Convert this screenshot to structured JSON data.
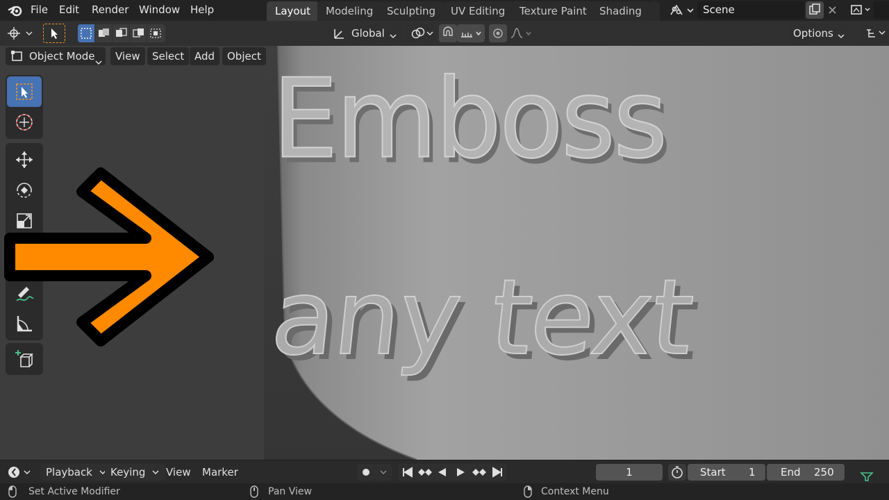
{
  "menu": {
    "items": [
      "File",
      "Edit",
      "Render",
      "Window",
      "Help"
    ]
  },
  "workspaces": {
    "tabs": [
      "Layout",
      "Modeling",
      "Sculpting",
      "UV Editing",
      "Texture Paint",
      "Shading"
    ],
    "active": "Layout"
  },
  "scene": {
    "name": "Scene"
  },
  "header": {
    "transform_orientation": "Global",
    "options_label": "Options"
  },
  "modebar": {
    "mode": "Object Mode",
    "view": "View",
    "select": "Select",
    "add": "Add",
    "object": "Object"
  },
  "viewport": {
    "line1": "Emboss",
    "line2": "any text"
  },
  "timeline": {
    "playback": "Playback",
    "keying": "Keying",
    "view": "View",
    "marker": "Marker",
    "current_frame": "1",
    "start_label": "Start",
    "start_value": "1",
    "end_label": "End",
    "end_value": "250"
  },
  "statusbar": {
    "left": "Set Active Modifier",
    "middle": "Pan View",
    "right": "Context Menu"
  },
  "colors": {
    "accent": "#4772b3",
    "arrow": "#ff8a00"
  }
}
